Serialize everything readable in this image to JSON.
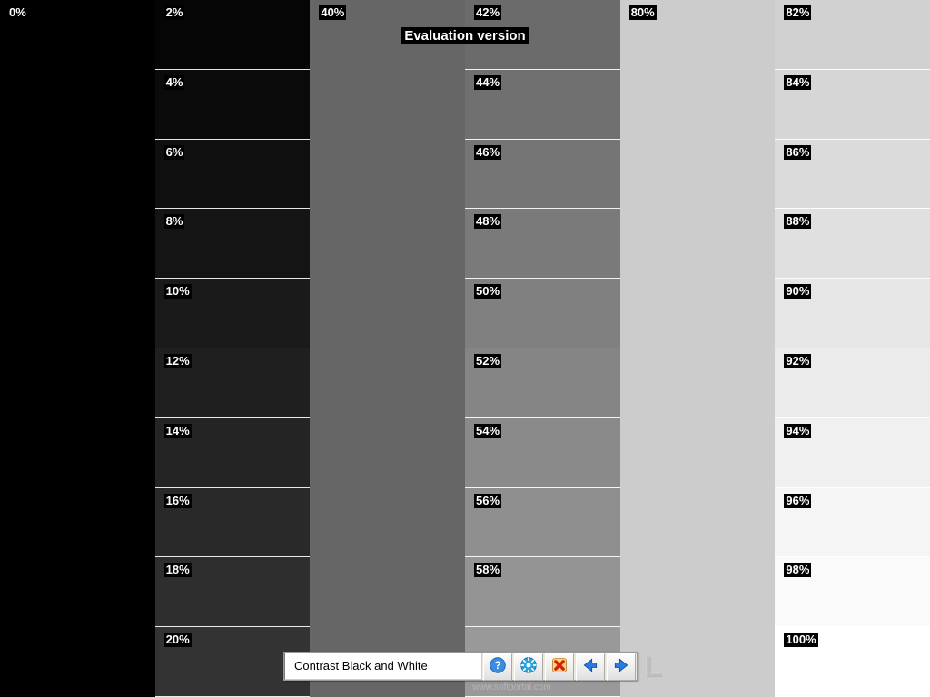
{
  "overlay": {
    "eval": "Evaluation version"
  },
  "watermark": {
    "text": "SOFTPORTAL",
    "url": "www.softportal.com"
  },
  "toolbar": {
    "caption": "Contrast Black and White",
    "buttons": {
      "help": "help-icon",
      "options": "options-icon",
      "close": "close-icon",
      "prev": "prev-arrow-icon",
      "next": "next-arrow-icon"
    }
  },
  "columns": [
    {
      "mode": "stepped",
      "start": 0,
      "labels": [
        "0%",
        "2%",
        "4%",
        "6%",
        "8%",
        "10%",
        "12%",
        "14%",
        "16%",
        "18%",
        "20%"
      ]
    },
    {
      "mode": "plain",
      "value": 40,
      "labels": [
        "40%"
      ]
    },
    {
      "mode": "stepped",
      "start": 42,
      "labels": [
        "42%",
        "44%",
        "46%",
        "48%",
        "50%",
        "52%",
        "54%",
        "56%",
        "58%"
      ]
    },
    {
      "mode": "plain",
      "value": 80,
      "labels": [
        "80%"
      ]
    },
    {
      "mode": "stepped",
      "start": 82,
      "labels": [
        "82%",
        "84%",
        "86%",
        "88%",
        "90%",
        "92%",
        "94%",
        "96%",
        "98%",
        "100%"
      ],
      "override_first_col": true
    }
  ],
  "colors": {
    "row_step_pct": 2
  }
}
